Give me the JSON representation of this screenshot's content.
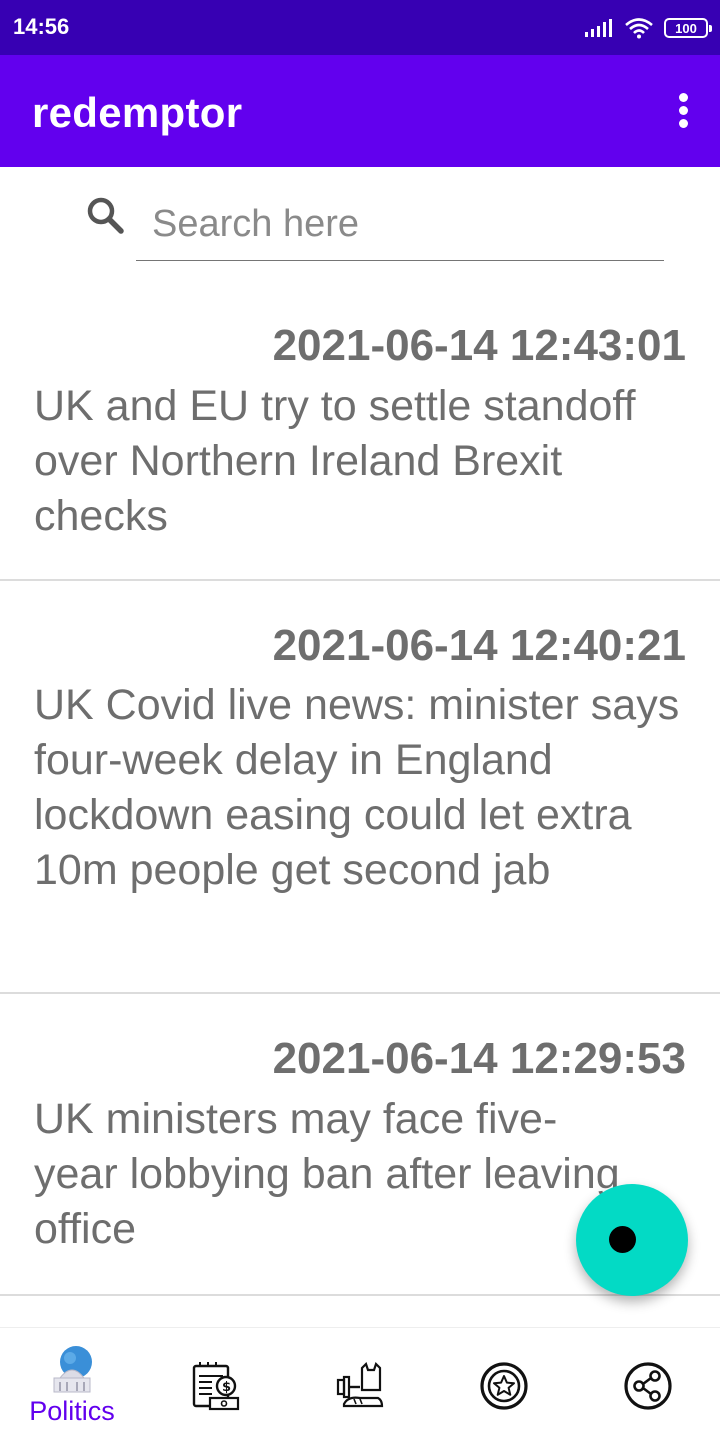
{
  "status_bar": {
    "time": "14:56",
    "battery": "100"
  },
  "app_bar": {
    "title": "redemptor",
    "menu_icon": "more-vert-icon"
  },
  "search": {
    "placeholder": "Search here",
    "value": "",
    "icon": "search-icon"
  },
  "news": [
    {
      "date": "2021-06-14 12:43:01",
      "title": "UK and EU try to settle standoff over Northern Ireland Brexit checks"
    },
    {
      "date": "2021-06-14 12:40:21",
      "title": "UK Covid live news: minister says four-week delay in England lockdown easing could let extra 10m people get second jab"
    },
    {
      "date": "2021-06-14 12:29:53",
      "title": "UK ministers may face five-year lobbying ban after leaving office"
    }
  ],
  "fab": {
    "icon": "record-icon",
    "color": "#03dac5"
  },
  "bottom_nav": {
    "items": [
      {
        "label": "Politics",
        "icon": "capitol-globe-icon",
        "selected": true
      },
      {
        "label": "",
        "icon": "business-newspaper-icon",
        "selected": false
      },
      {
        "label": "",
        "icon": "sports-fitness-icon",
        "selected": false
      },
      {
        "label": "",
        "icon": "star-badge-icon",
        "selected": false
      },
      {
        "label": "",
        "icon": "share-icon",
        "selected": false
      }
    ]
  },
  "colors": {
    "status_bar": "#3700b3",
    "primary": "#6200ee",
    "accent": "#03dac5",
    "text_secondary": "#6e6e6e"
  }
}
